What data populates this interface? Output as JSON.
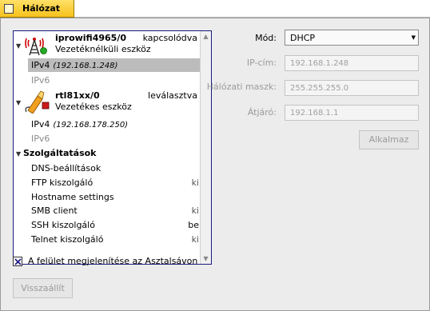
{
  "tab": {
    "title": "Hálózat"
  },
  "tree": {
    "devices": [
      {
        "name": "iprowifi4965/0",
        "state": "kapcsolódva",
        "type": "Vezetéknélküli eszköz",
        "icon": "wifi-tower-icon",
        "status_color": "#22aa22",
        "ipv4_label": "IPv4",
        "ipv4_addr": "(192.168.1.248)",
        "ipv6_label": "IPv6"
      },
      {
        "name": "rtl81xx/0",
        "state": "leválasztva",
        "type": "Vezetékes eszköz",
        "icon": "ethernet-plug-icon",
        "status_color": "#cc1a1a",
        "ipv4_label": "IPv4",
        "ipv4_addr": "(192.168.178.250)",
        "ipv6_label": "IPv6"
      }
    ],
    "services_header": "Szolgáltatások",
    "services": [
      {
        "name": "DNS-beállítások",
        "value": ""
      },
      {
        "name": "FTP kiszolgáló",
        "value": "ki"
      },
      {
        "name": "Hostname settings",
        "value": ""
      },
      {
        "name": "SMB client",
        "value": "ki"
      },
      {
        "name": "SSH kiszolgáló",
        "value": "be"
      },
      {
        "name": "Telnet kiszolgáló",
        "value": "ki"
      }
    ]
  },
  "form": {
    "mode_label": "Mód:",
    "mode_value": "DHCP",
    "ip_label": "IP-cím:",
    "ip_value": "192.168.1.248",
    "mask_label": "Hálózati maszk:",
    "mask_value": "255.255.255.0",
    "gateway_label": "Átjáró:",
    "gateway_value": "192.168.1.1",
    "apply_label": "Alkalmaz"
  },
  "show_in_deskbar": {
    "label": "A felület megjelenítése az Asztalsávon",
    "checked": true
  },
  "revert_label": "Visszaállít",
  "colors": {
    "tab": "#f7c21d",
    "selection": "#bcbcbc",
    "focus_border": "#1a1a80"
  }
}
